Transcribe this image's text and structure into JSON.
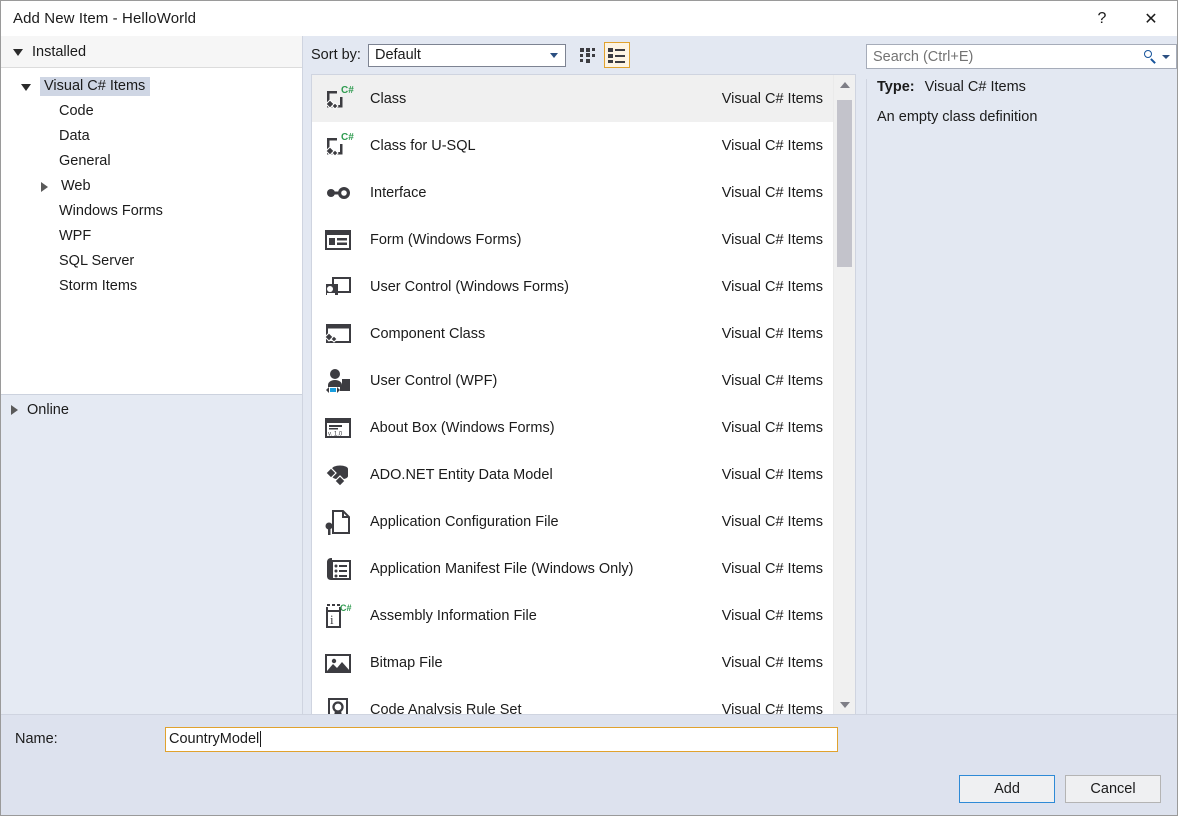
{
  "window": {
    "title": "Add New Item - HelloWorld",
    "help_label": "?",
    "close_label": "✕"
  },
  "sidebar": {
    "header": "Installed",
    "tree": [
      {
        "label": "Visual C# Items",
        "level": 1,
        "expander": "down",
        "selected": true
      },
      {
        "label": "Code",
        "level": 2,
        "expander": "none",
        "selected": false
      },
      {
        "label": "Data",
        "level": 2,
        "expander": "none",
        "selected": false
      },
      {
        "label": "General",
        "level": 2,
        "expander": "none",
        "selected": false
      },
      {
        "label": "Web",
        "level": 2,
        "expander": "right",
        "selected": false
      },
      {
        "label": "Windows Forms",
        "level": 2,
        "expander": "none",
        "selected": false
      },
      {
        "label": "WPF",
        "level": 2,
        "expander": "none",
        "selected": false
      },
      {
        "label": "SQL Server",
        "level": 2,
        "expander": "none",
        "selected": false
      },
      {
        "label": "Storm Items",
        "level": 2,
        "expander": "none",
        "selected": false
      }
    ],
    "online": "Online"
  },
  "toolbar": {
    "sort_label": "Sort by:",
    "sort_value": "Default",
    "sort_options": [
      "Default"
    ],
    "tiles_view_name": "tiles-view",
    "list_view_name": "list-view",
    "active_view": "list"
  },
  "search": {
    "placeholder": "Search (Ctrl+E)",
    "value": ""
  },
  "details": {
    "type_label": "Type:",
    "type_value": "Visual C# Items",
    "description": "An empty class definition"
  },
  "list": {
    "category_column": "Visual C# Items",
    "items": [
      {
        "name": "Class",
        "category": "Visual C# Items",
        "icon": "class-csharp-icon",
        "selected": true
      },
      {
        "name": "Class for U-SQL",
        "category": "Visual C# Items",
        "icon": "class-csharp-icon",
        "selected": false
      },
      {
        "name": "Interface",
        "category": "Visual C# Items",
        "icon": "interface-icon",
        "selected": false
      },
      {
        "name": "Form (Windows Forms)",
        "category": "Visual C# Items",
        "icon": "form-icon",
        "selected": false
      },
      {
        "name": "User Control (Windows Forms)",
        "category": "Visual C# Items",
        "icon": "user-control-icon",
        "selected": false
      },
      {
        "name": "Component Class",
        "category": "Visual C# Items",
        "icon": "component-class-icon",
        "selected": false
      },
      {
        "name": "User Control (WPF)",
        "category": "Visual C# Items",
        "icon": "user-control-wpf-icon",
        "selected": false
      },
      {
        "name": "About Box (Windows Forms)",
        "category": "Visual C# Items",
        "icon": "about-box-icon",
        "selected": false
      },
      {
        "name": "ADO.NET Entity Data Model",
        "category": "Visual C# Items",
        "icon": "ado-net-entity-icon",
        "selected": false
      },
      {
        "name": "Application Configuration File",
        "category": "Visual C# Items",
        "icon": "app-config-icon",
        "selected": false
      },
      {
        "name": "Application Manifest File (Windows Only)",
        "category": "Visual C# Items",
        "icon": "app-manifest-icon",
        "selected": false
      },
      {
        "name": "Assembly Information File",
        "category": "Visual C# Items",
        "icon": "assembly-info-icon",
        "selected": false
      },
      {
        "name": "Bitmap File",
        "category": "Visual C# Items",
        "icon": "bitmap-icon",
        "selected": false
      },
      {
        "name": "Code Analysis Rule Set",
        "category": "Visual C# Items",
        "icon": "rule-set-icon",
        "selected": false
      }
    ]
  },
  "footer": {
    "name_label": "Name:",
    "name_value": "CountryModel",
    "add_label": "Add",
    "cancel_label": "Cancel"
  },
  "colors": {
    "accent_focus": "#e0a22e",
    "default_button_border": "#2e8ad6",
    "panel_background": "#e3e8f2",
    "selection": "#cfd6e4",
    "csharp_green": "#2e9b4f"
  }
}
